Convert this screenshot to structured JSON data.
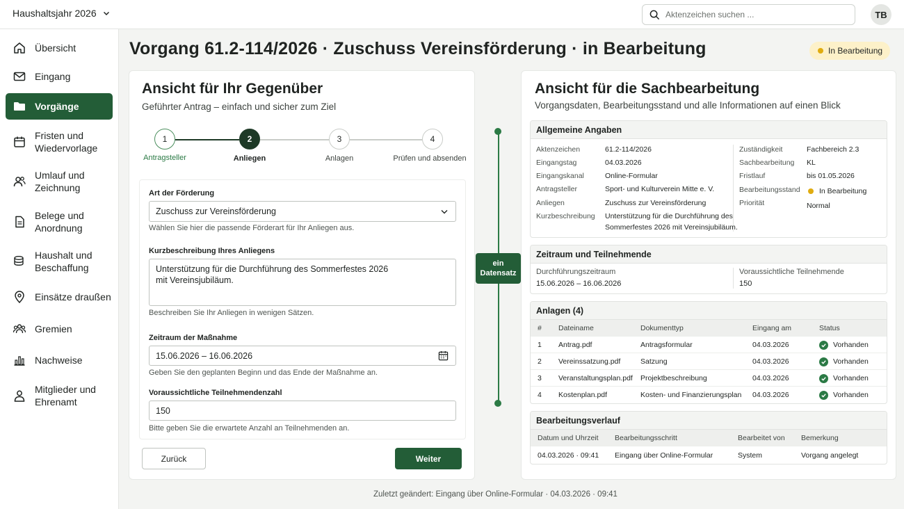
{
  "header": {
    "year_label": "Haushaltsjahr 2026",
    "search_placeholder": "Aktenzeichen suchen ...",
    "avatar_initials": "TB"
  },
  "sidebar": {
    "items": [
      {
        "label": "Übersicht",
        "icon": "home-icon"
      },
      {
        "label": "Eingang",
        "icon": "mail-icon"
      },
      {
        "label": "Vorgänge",
        "icon": "folder-icon",
        "active": true
      },
      {
        "label": "Fristen und Wiedervorlage",
        "icon": "calendar-icon"
      },
      {
        "label": "Umlauf und Zeichnung",
        "icon": "users-icon"
      },
      {
        "label": "Belege und Anordnung",
        "icon": "document-icon"
      },
      {
        "label": "Haushalt und Beschaffung",
        "icon": "coins-icon"
      },
      {
        "label": "Einsätze draußen",
        "icon": "location-pin-icon"
      },
      {
        "label": "Gremien",
        "icon": "group-icon"
      },
      {
        "label": "Nachweise",
        "icon": "bar-chart-icon"
      },
      {
        "label": "Mitglieder und Ehrenamt",
        "icon": "person-icon"
      }
    ]
  },
  "page": {
    "title": "Vorgang 61.2-114/2026 · Zuschuss Vereinsförderung · in Bearbeitung",
    "status": "In Bearbeitung",
    "status_color": "#e0ac10"
  },
  "left_card": {
    "title": "Ansicht für Ihr Gegenüber",
    "subtitle": "Geführter Antrag – einfach und sicher zum Ziel",
    "steps": [
      {
        "number": "1",
        "label": "Antragsteller",
        "state": "done"
      },
      {
        "number": "2",
        "label": "Anliegen",
        "state": "active"
      },
      {
        "number": "3",
        "label": "Anlagen",
        "state": "pending"
      },
      {
        "number": "4",
        "label": "Prüfen und absenden",
        "state": "pending"
      }
    ],
    "form": {
      "type_label": "Art der Förderung",
      "type_value": "Zuschuss zur Vereinsförderung",
      "type_hint": "Wählen Sie hier die passende Förderart für Ihr Anliegen aus.",
      "desc_label": "Kurzbeschreibung Ihres Anliegens",
      "desc_value": "Unterstützung für die Durchführung des Sommerfestes 2026\nmit Vereinsjubiläum.",
      "desc_hint": "Beschreiben Sie Ihr Anliegen in wenigen Sätzen.",
      "period_label": "Zeitraum der Maßnahme",
      "period_value": "15.06.2026 – 16.06.2026",
      "period_hint": "Geben Sie den geplanten Beginn und das Ende der Maßnahme an.",
      "participants_label": "Voraussichtliche Teilnehmendenzahl",
      "participants_value": "150",
      "participants_hint": "Bitte geben Sie die erwartete Anzahl an Teilnehmenden an."
    },
    "back_label": "Zurück",
    "next_label": "Weiter"
  },
  "connector": {
    "line1": "ein",
    "line2": "Datensatz"
  },
  "right_card": {
    "title": "Ansicht für die Sachbearbeitung",
    "subtitle": "Vorgangsdaten, Bearbeitungsstand und alle Informationen auf einen Blick",
    "general": {
      "heading": "Allgemeine Angaben",
      "left": [
        {
          "key": "Aktenzeichen",
          "value": "61.2-114/2026"
        },
        {
          "key": "Eingangstag",
          "value": "04.03.2026"
        },
        {
          "key": "Eingangskanal",
          "value": "Online-Formular"
        },
        {
          "key": "Antragsteller",
          "value": "Sport- und Kulturverein Mitte e. V."
        },
        {
          "key": "Anliegen",
          "value": "Zuschuss zur Vereinsförderung"
        },
        {
          "key": "Kurzbeschreibung",
          "value": "Unterstützung für die Durchführung des",
          "value2": "Sommerfestes 2026 mit Vereinsjubiläum."
        }
      ],
      "right": [
        {
          "key": "Zuständigkeit",
          "value": "Fachbereich 2.3"
        },
        {
          "key": "Sachbearbeitung",
          "value": "KL"
        },
        {
          "key": "Fristlauf",
          "value": "bis 01.05.2026"
        },
        {
          "key": "Bearbeitungsstand",
          "value": "In Bearbeitung"
        },
        {
          "key": "Priorität",
          "value": "Normal"
        }
      ]
    },
    "period": {
      "heading": "Zeitraum und Teilnehmende",
      "period_key": "Durchführungszeitraum",
      "period_value": "15.06.2026 – 16.06.2026",
      "participants_key": "Voraussichtliche Teilnehmende",
      "participants_value": "150"
    },
    "attachments": {
      "heading": "Anlagen (4)",
      "columns": [
        "#",
        "Dateiname",
        "Dokumenttyp",
        "Eingang am",
        "Status"
      ],
      "rows": [
        [
          "1",
          "Antrag.pdf",
          "Antragsformular",
          "04.03.2026",
          "Vorhanden"
        ],
        [
          "2",
          "Vereinssatzung.pdf",
          "Satzung",
          "04.03.2026",
          "Vorhanden"
        ],
        [
          "3",
          "Veranstaltungsplan.pdf",
          "Projektbeschreibung",
          "04.03.2026",
          "Vorhanden"
        ],
        [
          "4",
          "Kostenplan.pdf",
          "Kosten- und Finanzierungsplan",
          "04.03.2026",
          "Vorhanden"
        ]
      ]
    },
    "history": {
      "heading": "Bearbeitungsverlauf",
      "columns": [
        "Datum und Uhrzeit",
        "Bearbeitungsschritt",
        "Bearbeitet von",
        "Bemerkung"
      ],
      "rows": [
        [
          "04.03.2026 · 09:41",
          "Eingang über Online-Formular",
          "System",
          "Vorgang angelegt"
        ]
      ]
    }
  },
  "footer": {
    "note": "Zuletzt geändert: Eingang über Online-Formular · 04.03.2026 · 09:41"
  }
}
